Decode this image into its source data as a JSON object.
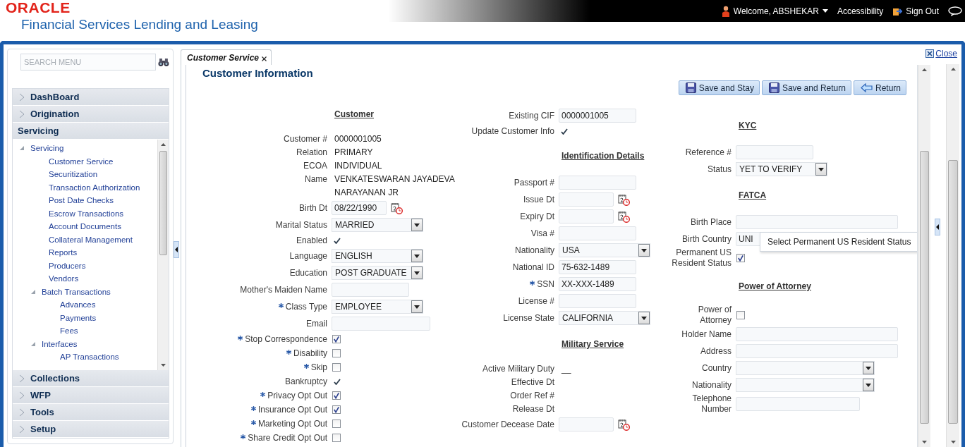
{
  "header": {
    "brand": "ORACLE",
    "product": "Financial Services Lending and Leasing",
    "user": "Welcome, ABSHEKAR",
    "accessibility": "Accessibility",
    "sign_out": "Sign Out"
  },
  "sidebar": {
    "search": {
      "placeholder": "SEARCH MENU"
    },
    "sections": [
      {
        "label": "DashBoard",
        "expanded": false
      },
      {
        "label": "Origination",
        "expanded": false
      },
      {
        "label": "Servicing",
        "expanded": true,
        "tree": [
          {
            "label": "Servicing",
            "expanded": true,
            "children": [
              {
                "label": "Customer Service"
              },
              {
                "label": "Securitization"
              },
              {
                "label": "Transaction Authorization"
              },
              {
                "label": "Post Date Checks"
              },
              {
                "label": "Escrow Transactions"
              },
              {
                "label": "Account Documents"
              },
              {
                "label": "Collateral Management"
              },
              {
                "label": "Reports"
              },
              {
                "label": "Producers"
              },
              {
                "label": "Vendors"
              },
              {
                "label": "Batch Transactions",
                "expanded": true,
                "children": [
                  {
                    "label": "Advances"
                  },
                  {
                    "label": "Payments"
                  },
                  {
                    "label": "Fees"
                  }
                ]
              },
              {
                "label": "Interfaces",
                "expanded": true,
                "children": [
                  {
                    "label": "AP Transactions"
                  }
                ]
              }
            ]
          }
        ]
      },
      {
        "label": "Collections",
        "expanded": false
      },
      {
        "label": "WFP",
        "expanded": false
      },
      {
        "label": "Tools",
        "expanded": false
      },
      {
        "label": "Setup",
        "expanded": false
      }
    ]
  },
  "tabs": [
    {
      "label": "Customer Service",
      "selected": true
    }
  ],
  "close": "Close",
  "title": "Customer Information",
  "buttons": [
    {
      "label": "Save and Stay",
      "kind": "save"
    },
    {
      "label": "Save and Return",
      "kind": "save"
    },
    {
      "label": "Return",
      "kind": "back"
    }
  ],
  "columns": [
    [
      {
        "kind": "heading",
        "label": "Customer"
      },
      {
        "kind": "text",
        "label": "Customer #",
        "value": "0000001005"
      },
      {
        "kind": "text",
        "label": "Relation",
        "value": "PRIMARY"
      },
      {
        "kind": "text",
        "label": "ECOA",
        "value": "INDIVIDUAL"
      },
      {
        "kind": "text",
        "label": "Name",
        "value": "VENKATESWARAN JAYADEVA NARAYANAN JR"
      },
      {
        "kind": "date",
        "label": "Birth Dt",
        "value": "08/22/1990"
      },
      {
        "kind": "select",
        "label": "Marital Status",
        "value": "MARRIED"
      },
      {
        "kind": "check",
        "label": "Enabled",
        "checked": true
      },
      {
        "kind": "select",
        "label": "Language",
        "value": "ENGLISH"
      },
      {
        "kind": "select",
        "label": "Education",
        "value": "POST GRADUATE"
      },
      {
        "kind": "input",
        "label": "Mother's Maiden Name"
      },
      {
        "kind": "select",
        "label": "Class Type",
        "value": "EMPLOYEE",
        "required": true
      },
      {
        "kind": "input",
        "label": "Email"
      },
      {
        "kind": "checkbox",
        "label": "Stop Correspondence",
        "required": true,
        "checked": true
      },
      {
        "kind": "checkbox",
        "label": "Disability",
        "required": true,
        "checked": false
      },
      {
        "kind": "checkbox",
        "label": "Skip",
        "required": true,
        "checked": false
      },
      {
        "kind": "check",
        "label": "Bankruptcy",
        "checked": true
      },
      {
        "kind": "checkbox",
        "label": "Privacy Opt Out",
        "required": true,
        "checked": true
      },
      {
        "kind": "checkbox",
        "label": "Insurance Opt Out",
        "required": true,
        "checked": true
      },
      {
        "kind": "checkbox",
        "label": "Marketing Opt Out",
        "required": true,
        "checked": false
      },
      {
        "kind": "checkbox",
        "label": "Share Credit Opt Out",
        "required": true,
        "checked": false
      }
    ],
    [
      {
        "kind": "input",
        "label": "Existing CIF",
        "value": "0000001005"
      },
      {
        "kind": "check",
        "label": "Update Customer Info",
        "checked": true
      },
      {
        "kind": "heading",
        "label": "Identification Details"
      },
      {
        "kind": "input",
        "label": "Passport #"
      },
      {
        "kind": "date",
        "label": "Issue Dt"
      },
      {
        "kind": "date",
        "label": "Expiry Dt"
      },
      {
        "kind": "input",
        "label": "Visa #"
      },
      {
        "kind": "select",
        "label": "Nationality",
        "value": "USA"
      },
      {
        "kind": "input",
        "label": "National ID",
        "value": "75-632-1489"
      },
      {
        "kind": "input",
        "label": "SSN",
        "value": "XX-XXX-1489",
        "required": true
      },
      {
        "kind": "input",
        "label": "License #"
      },
      {
        "kind": "select",
        "label": "License State",
        "value": "CALIFORNIA"
      },
      {
        "kind": "heading",
        "label": "Military Service"
      },
      {
        "kind": "text",
        "label": "Active Military Duty",
        "value": "__"
      },
      {
        "kind": "text",
        "label": "Effective Dt"
      },
      {
        "kind": "text",
        "label": "Order Ref #"
      },
      {
        "kind": "text",
        "label": "Release Dt"
      },
      {
        "kind": "date",
        "label": "Customer Decease Date"
      }
    ],
    [
      {
        "kind": "heading",
        "label": "KYC"
      },
      {
        "kind": "input",
        "label": "Reference #"
      },
      {
        "kind": "select",
        "label": "Status",
        "value": "YET TO VERIFY"
      },
      {
        "kind": "heading",
        "label": "FATCA"
      },
      {
        "kind": "input",
        "label": "Birth Place"
      },
      {
        "kind": "input",
        "label": "Birth Country",
        "value": "UNI"
      },
      {
        "kind": "checkbox",
        "label": "Permanent US Resident Status",
        "checked": true,
        "tooltip": "Select Permanent US Resident Status"
      },
      {
        "kind": "heading",
        "label": "Power of Attorney"
      },
      {
        "kind": "checkbox",
        "label": "Power of Attorney",
        "checked": false
      },
      {
        "kind": "input",
        "label": "Holder Name"
      },
      {
        "kind": "input",
        "label": "Address"
      },
      {
        "kind": "select",
        "label": "Country"
      },
      {
        "kind": "select",
        "label": "Nationality"
      },
      {
        "kind": "input",
        "label": "Telephone Number"
      }
    ]
  ]
}
